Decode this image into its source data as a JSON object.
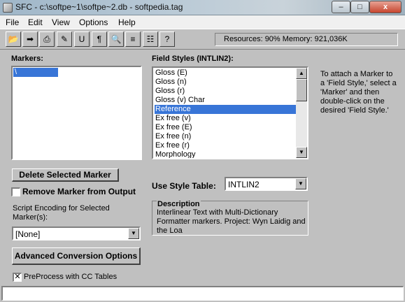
{
  "window": {
    "title": "SFC - c:\\softpe~1\\softpe~2.db - softpedia.tag",
    "min_glyph": "–",
    "max_glyph": "□",
    "close_glyph": "x"
  },
  "menu": {
    "items": [
      "File",
      "Edit",
      "View",
      "Options",
      "Help"
    ]
  },
  "toolbar": {
    "buttons": [
      {
        "icon": "open-folder-icon",
        "glyph": "📂"
      },
      {
        "icon": "arrow-right-icon",
        "glyph": "➡"
      },
      {
        "icon": "export-icon",
        "glyph": "⎙"
      },
      {
        "icon": "edit-table-icon",
        "glyph": "✎"
      },
      {
        "icon": "unicode-icon",
        "glyph": "U"
      },
      {
        "icon": "script-icon",
        "glyph": "¶"
      },
      {
        "icon": "find-icon",
        "glyph": "🔍"
      },
      {
        "icon": "compare-icon",
        "glyph": "≡"
      },
      {
        "icon": "style-grid-icon",
        "glyph": "☷"
      },
      {
        "icon": "help-icon",
        "glyph": "?"
      }
    ],
    "status": "Resources: 90%  Memory: 921,036K"
  },
  "markers": {
    "label": "Markers:",
    "items": [
      "\\"
    ]
  },
  "field_styles": {
    "label": "Field Styles (INTLIN2):",
    "items": [
      "Gloss (E)",
      "Gloss (n)",
      "Gloss (r)",
      "Gloss (v) Char",
      "Reference",
      "Ex free (v)",
      "Ex free (E)",
      "Ex free (n)",
      "Ex free (r)",
      "Morphology"
    ],
    "selected_index": 4
  },
  "hint_text": "To attach a Marker to a 'Field Style,' select a 'Marker' and then double-click on the desired 'Field Style.'",
  "delete_button": "Delete Selected Marker",
  "remove_marker": {
    "label": "Remove Marker from Output",
    "checked": false
  },
  "script_encoding": {
    "label": "Script Encoding for Selected Marker(s):",
    "value": "[None]"
  },
  "use_style_table": {
    "label": "Use Style Table:",
    "value": "INTLIN2"
  },
  "description": {
    "label": "Description",
    "text": "Interlinear Text with Multi-Dictionary Formatter markers. Project: Wyn Laidig and the Loa"
  },
  "advanced_button": "Advanced Conversion Options",
  "preprocess": {
    "label": "PreProcess with CC Tables",
    "checked": true,
    "mark": "✕"
  },
  "scroll": {
    "up_glyph": "▲",
    "down_glyph": "▼"
  }
}
